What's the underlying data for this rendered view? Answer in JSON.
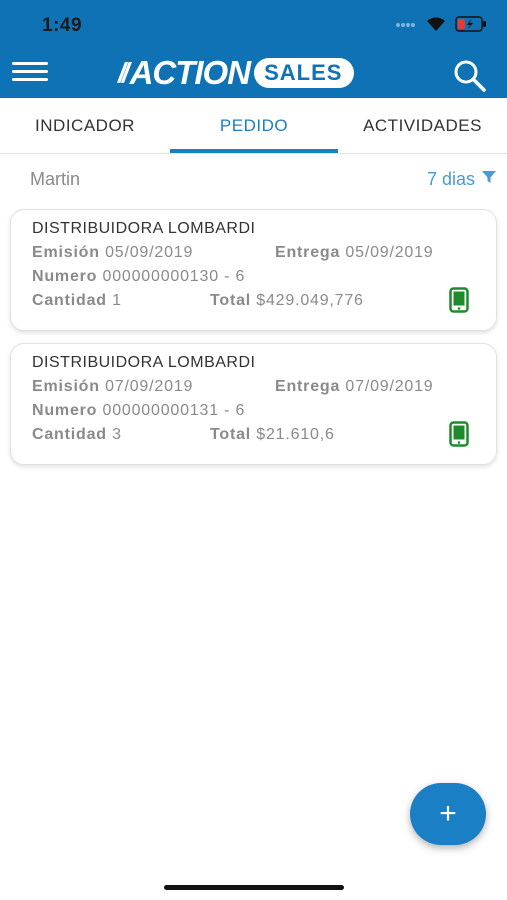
{
  "status_bar": {
    "time": "1:49"
  },
  "header": {
    "logo_prefix": "//",
    "logo_main": "ACTION",
    "logo_badge": "SALES"
  },
  "tabs": [
    {
      "label": "INDICADOR",
      "active": false
    },
    {
      "label": "PEDIDO",
      "active": true
    },
    {
      "label": "ACTIVIDADES",
      "active": false
    }
  ],
  "filter": {
    "seller": "Martin",
    "period": "7 dias"
  },
  "orders": [
    {
      "client": "DISTRIBUIDORA LOMBARDI",
      "emision_label": "Emisión",
      "emision": "05/09/2019",
      "entrega_label": "Entrega",
      "entrega": "05/09/2019",
      "numero_label": "Numero",
      "numero": "000000000130 - 6",
      "cantidad_label": "Cantidad",
      "cantidad": "1",
      "total_label": "Total",
      "total": "$429.049,776"
    },
    {
      "client": "DISTRIBUIDORA LOMBARDI",
      "emision_label": "Emisión",
      "emision": "07/09/2019",
      "entrega_label": "Entrega",
      "entrega": "07/09/2019",
      "numero_label": "Numero",
      "numero": "000000000131 - 6",
      "cantidad_label": "Cantidad",
      "cantidad": "3",
      "total_label": "Total",
      "total": "$21.610,6"
    }
  ],
  "fab": {
    "label": "+"
  },
  "colors": {
    "primary": "#0e72b5",
    "accent": "#1a7fc4",
    "device_icon": "#1f8a2b",
    "battery_low": "#e53935"
  }
}
